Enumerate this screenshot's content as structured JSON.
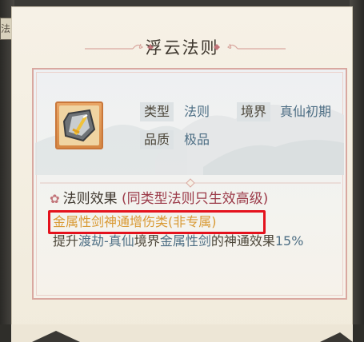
{
  "side_tab": {
    "label": "法则"
  },
  "title": "浮云法则",
  "item": {
    "type_label": "类型",
    "type_value": "法则",
    "realm_label": "境界",
    "realm_value": "真仙初期",
    "quality_label": "品质",
    "quality_value": "极品",
    "icon": "sword-shard-icon"
  },
  "effect": {
    "heading": "法则效果",
    "note": "(同类型法则只生效高级)",
    "type_line": "金属性剑神通增伤类(非专属)",
    "desc": {
      "prefix": "提升",
      "stage": "渡劫-真仙",
      "mid": "境界",
      "attr": "金属性剑",
      "mid2": "的神通效果",
      "value": "15%"
    }
  },
  "colors": {
    "paper": "#f6f1e6",
    "accent_blue": "#4d6e84",
    "accent_orange": "#d99a35",
    "note_red": "#9b3a48",
    "highlight_red": "#e4121d"
  }
}
